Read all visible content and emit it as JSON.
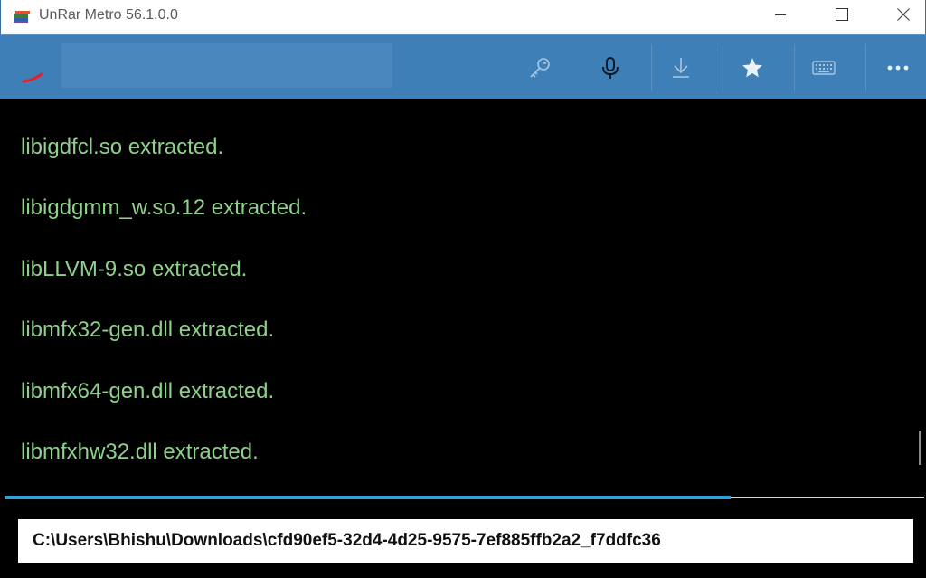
{
  "window": {
    "title": "UnRar Metro 56.1.0.0"
  },
  "toolbar": {
    "search_placeholder": "",
    "icons": {
      "key": "key-icon",
      "mic": "microphone-icon",
      "download": "download-icon",
      "star": "star-icon",
      "keyboard": "keyboard-icon",
      "more": "more-icon"
    }
  },
  "log": {
    "lines": [
      "libigdfcl.so extracted.",
      "libigdgmm_w.so.12 extracted.",
      "libLLVM-9.so extracted.",
      "libmfx32-gen.dll extracted.",
      "libmfx64-gen.dll extracted.",
      "libmfxhw32.dll extracted."
    ]
  },
  "progress": {
    "fraction": 0.79
  },
  "path": {
    "value": "C:\\Users\\Bhishu\\Downloads\\cfd90ef5-32d4-4d25-9575-7ef885ffb2a2_f7ddfc36"
  },
  "colors": {
    "toolbar_bg": "#3f7fb8",
    "log_text": "#8fd18a",
    "progress": "#2aa3db"
  }
}
